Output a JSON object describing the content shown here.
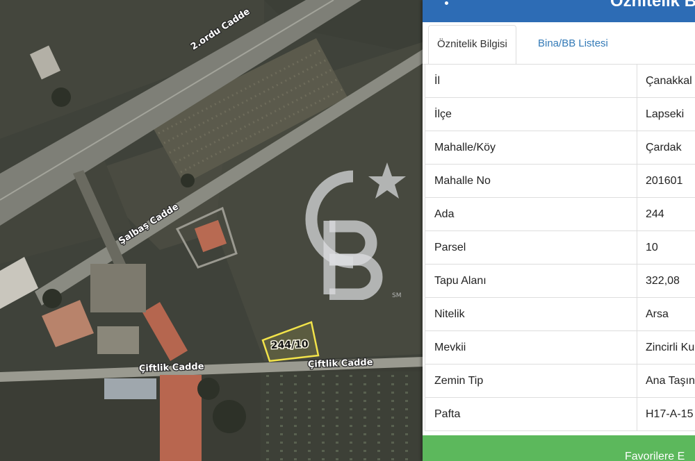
{
  "map": {
    "street_labels": [
      "2.ordu Cadde",
      "Şalbaş Cadde",
      "Çiftlik Cadde",
      "Çiftlik Cadde"
    ],
    "parcel_label": "244/10",
    "watermark": {
      "letters": "CB",
      "mark": "SM"
    },
    "colors": {
      "parcel_outline": "#f2e34a",
      "road": "#8e8f86"
    }
  },
  "panel": {
    "header_title": "Öznitelik B",
    "menu_icon": "kebab-menu-icon",
    "tabs": [
      {
        "label": "Öznitelik Bilgisi",
        "active": true
      },
      {
        "label": "Bina/BB Listesi",
        "active": false
      }
    ],
    "rows": [
      {
        "key": "İl",
        "value": "Çanakkal"
      },
      {
        "key": "İlçe",
        "value": "Lapseki"
      },
      {
        "key": "Mahalle/Köy",
        "value": "Çardak"
      },
      {
        "key": "Mahalle No",
        "value": "201601"
      },
      {
        "key": "Ada",
        "value": "244"
      },
      {
        "key": "Parsel",
        "value": "10"
      },
      {
        "key": "Tapu Alanı",
        "value": "322,08"
      },
      {
        "key": "Nitelik",
        "value": "Arsa"
      },
      {
        "key": "Mevkii",
        "value": "Zincirli Ku"
      },
      {
        "key": "Zemin Tip",
        "value": "Ana Taşın"
      },
      {
        "key": "Pafta",
        "value": "H17-A-15"
      }
    ],
    "favorite_button": "Favorilere E",
    "colors": {
      "header": "#2d6cb5",
      "tab_link": "#337ab7",
      "favorite": "#5cb85c"
    }
  }
}
